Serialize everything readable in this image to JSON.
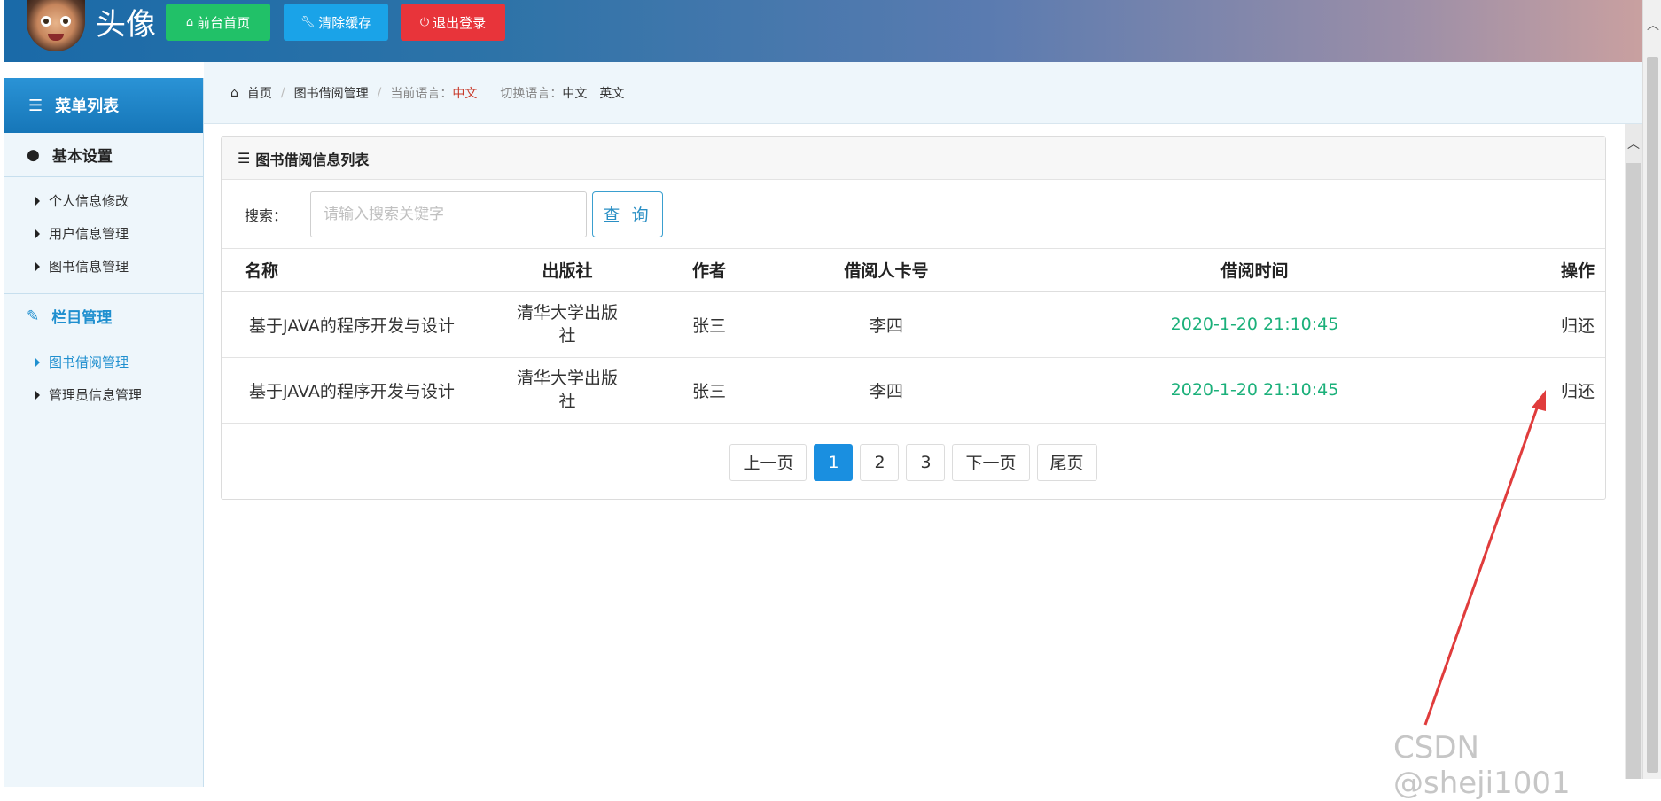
{
  "header": {
    "site_title": "头像",
    "buttons": [
      {
        "label": "前台首页",
        "icon": "home-icon",
        "color": "#21c168"
      },
      {
        "label": "清除缓存",
        "icon": "wrench-icon",
        "color": "#1aa3e8"
      },
      {
        "label": "退出登录",
        "icon": "power-icon",
        "color": "#e8343a"
      }
    ]
  },
  "sidebar": {
    "title": "菜单列表",
    "sections": [
      {
        "label": "基本设置",
        "icon": "user-icon",
        "items": [
          "个人信息修改",
          "用户信息管理",
          "图书信息管理"
        ]
      },
      {
        "label": "栏目管理",
        "icon": "edit-icon",
        "items": [
          "图书借阅管理",
          "管理员信息管理"
        ],
        "active_item": "图书借阅管理"
      }
    ]
  },
  "breadcrumb": {
    "home": "首页",
    "current": "图书借阅管理",
    "lang_label": "当前语言：",
    "lang_value": "中文",
    "switch_label": "切换语言：",
    "switch_zh": "中文",
    "switch_en": "英文"
  },
  "panel": {
    "title": "图书借阅信息列表",
    "search_label": "搜索：",
    "search_placeholder": "请输入搜索关键字",
    "search_button": "查 询",
    "columns": [
      "名称",
      "出版社",
      "作者",
      "借阅人卡号",
      "借阅时间",
      "操作"
    ],
    "rows": [
      {
        "name": "基于JAVA的程序开发与设计",
        "publisher": "清华大学出版社",
        "author": "张三",
        "card": "李四",
        "time": "2020-1-20 21:10:45",
        "action": "归还"
      },
      {
        "name": "基于JAVA的程序开发与设计",
        "publisher": "清华大学出版社",
        "author": "张三",
        "card": "李四",
        "time": "2020-1-20 21:10:45",
        "action": "归还"
      }
    ],
    "pager": {
      "prev": "上一页",
      "pages": [
        "1",
        "2",
        "3"
      ],
      "current": "1",
      "next": "下一页",
      "last": "尾页"
    }
  },
  "watermark": "CSDN @sheji1001",
  "colors": {
    "accent": "#1f8fcf",
    "time_text": "#1bb07a",
    "annotation_arrow": "#e03c3c"
  }
}
